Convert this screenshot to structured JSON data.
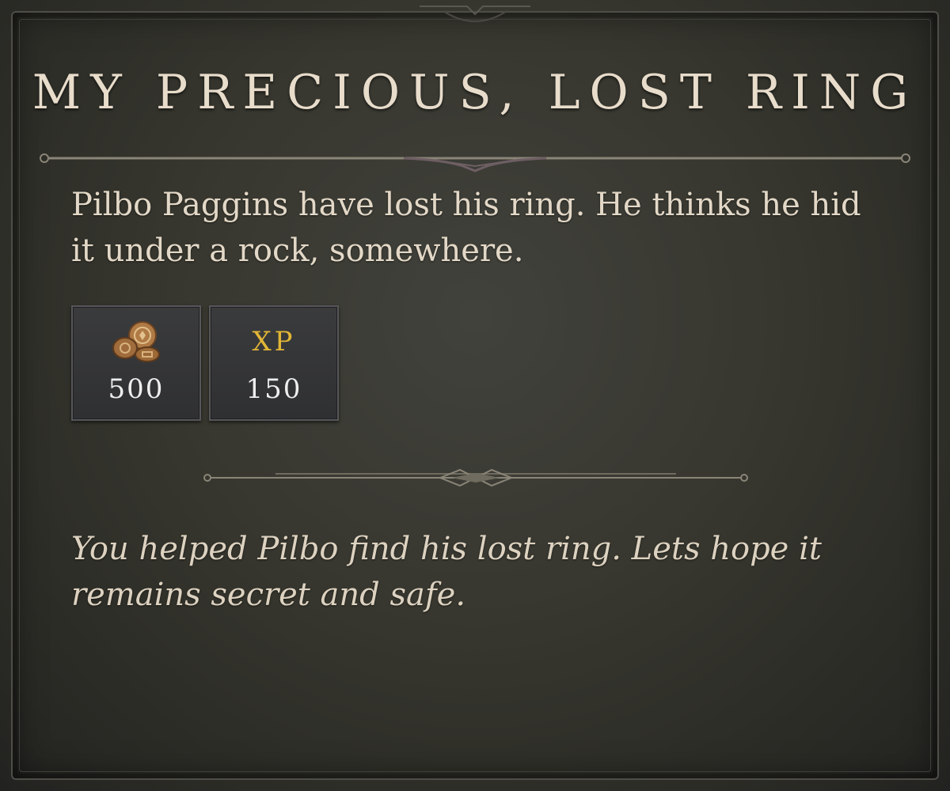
{
  "quest": {
    "title": "My Precious, Lost Ring",
    "description": "Pilbo Paggins have lost his ring. He thinks he hid it under a rock, somewhere.",
    "completion_text": "You helped Pilbo find his lost ring. Lets hope it remains secret and safe."
  },
  "rewards": [
    {
      "icon": "gold-coins-icon",
      "value": "500"
    },
    {
      "label": "XP",
      "value": "150"
    }
  ],
  "colors": {
    "background": "#37372f",
    "title_text": "#e8dccb",
    "body_text": "#e3d8c7",
    "xp_gold": "#e2b636",
    "divider": "#8a8577"
  }
}
